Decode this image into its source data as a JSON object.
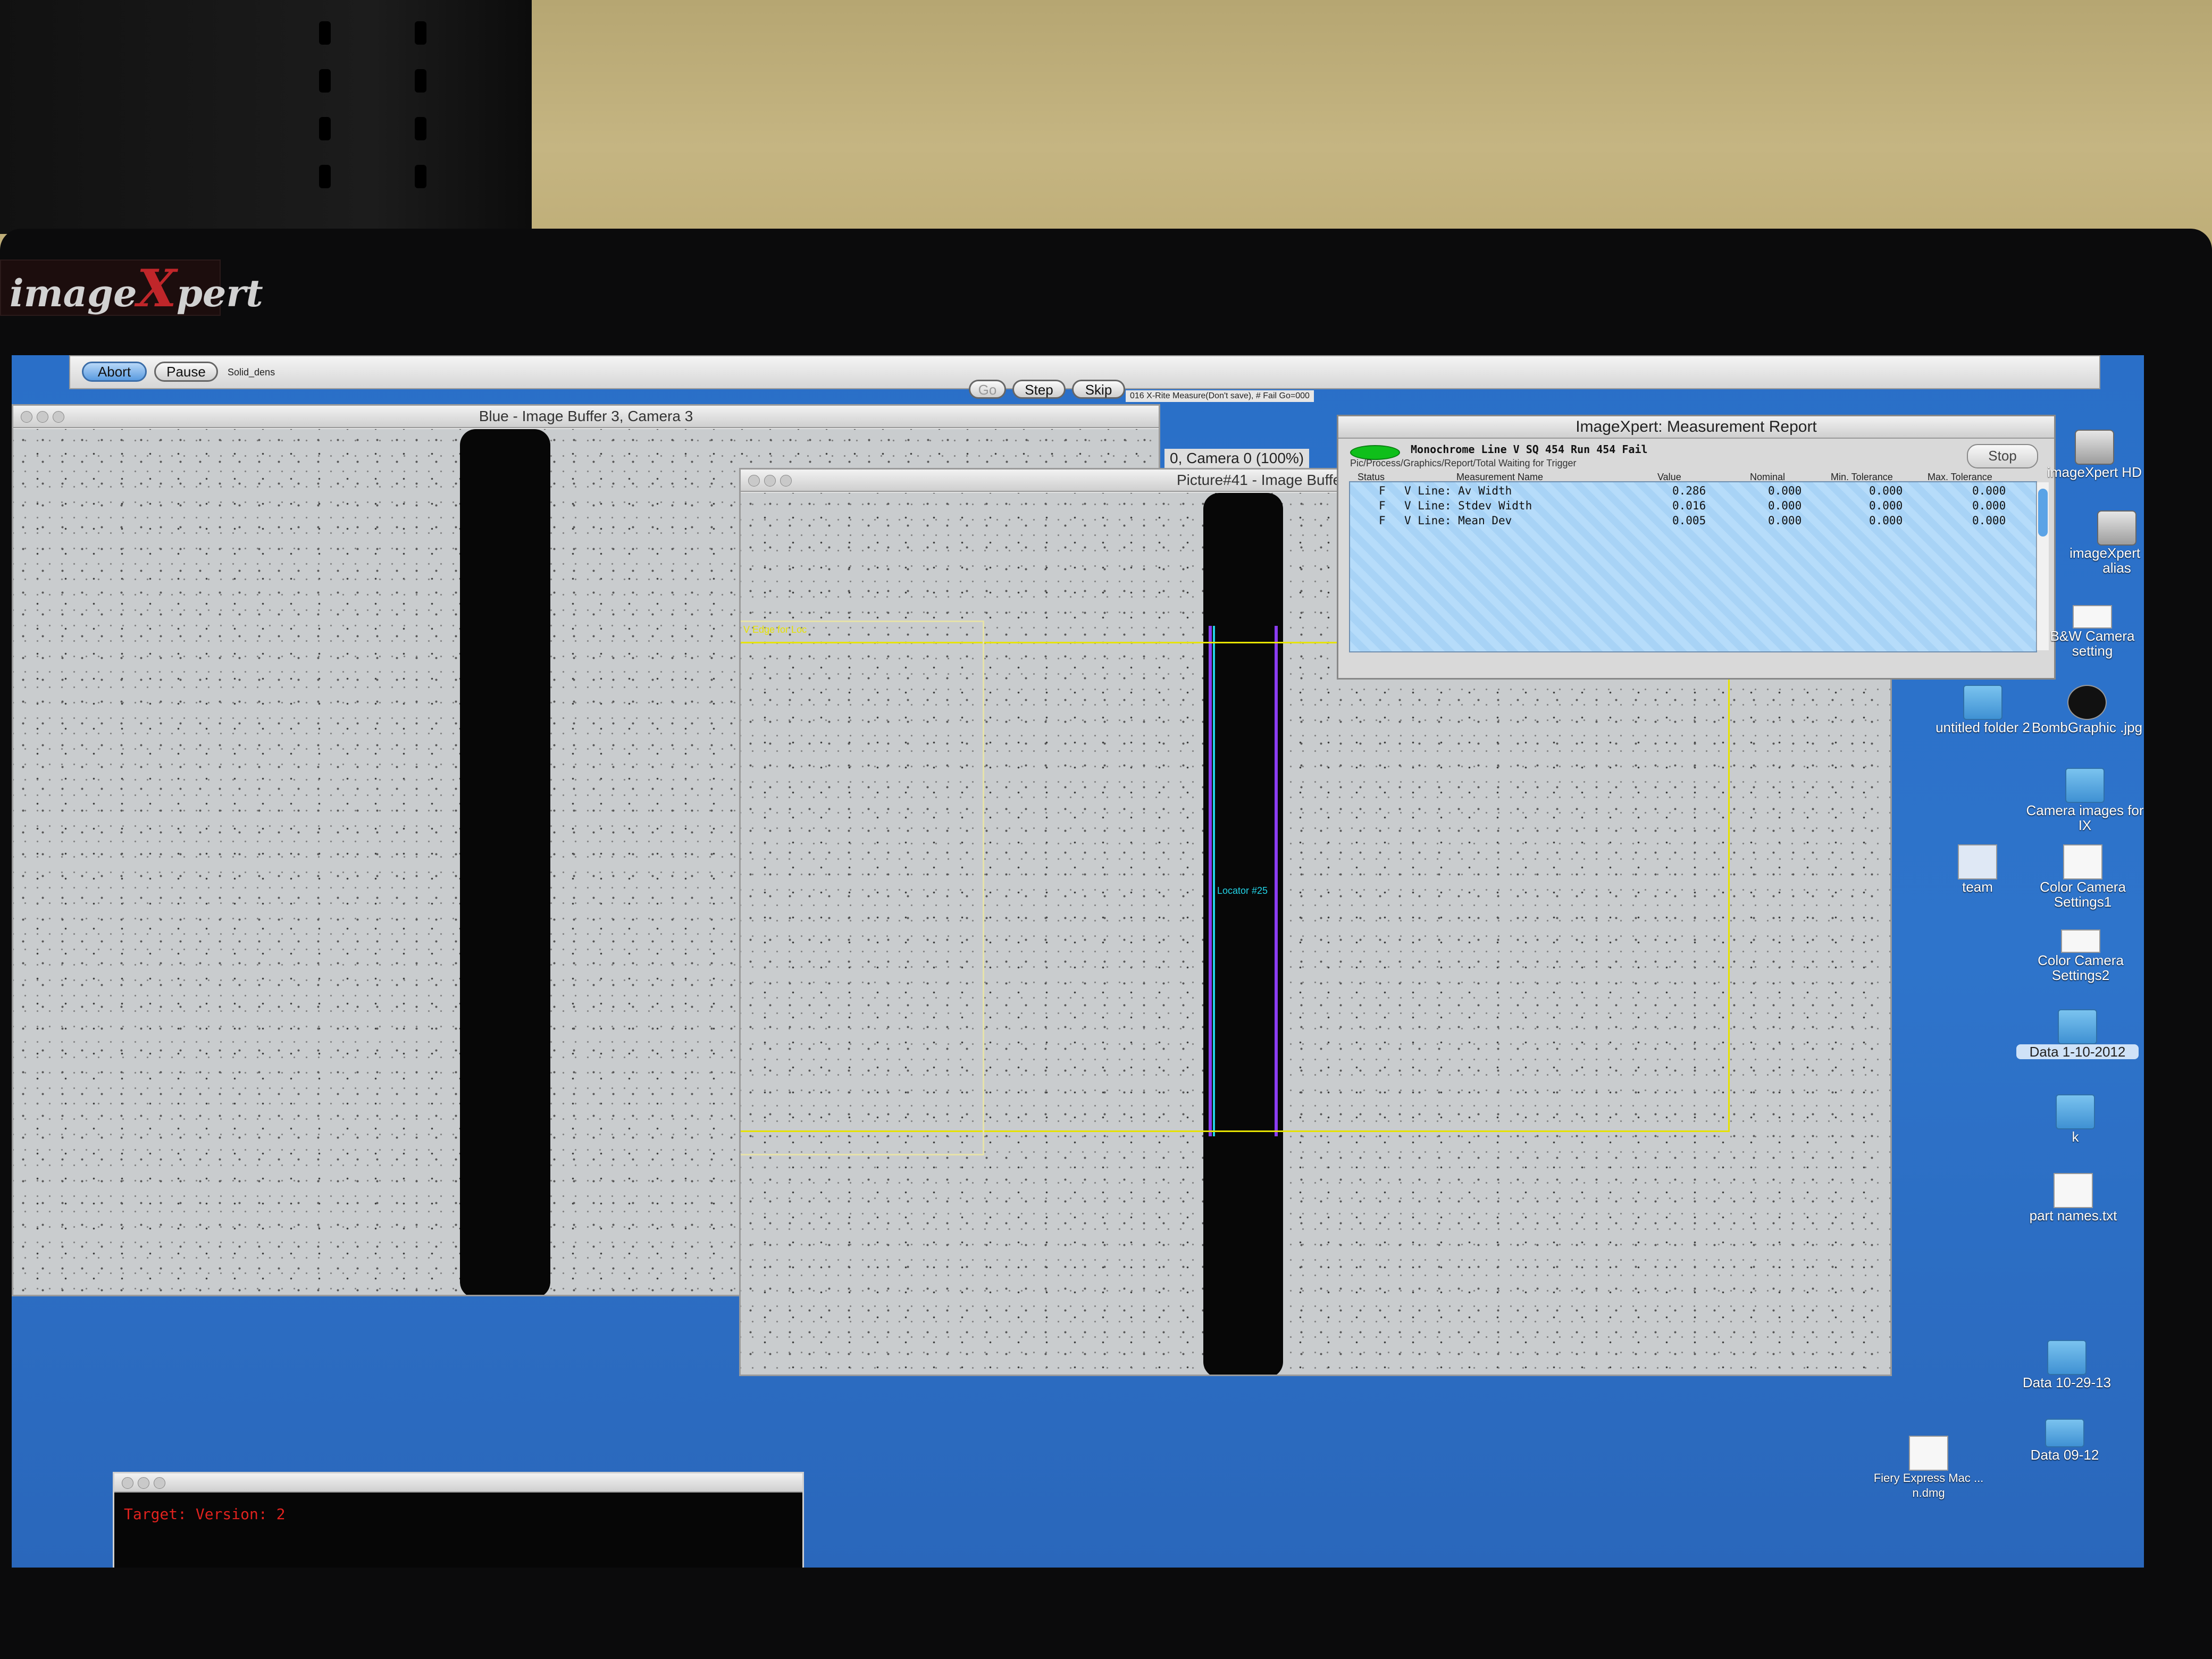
{
  "brand": {
    "logo_text": "imageXpert"
  },
  "toolbar": {
    "abort_label": "Abort",
    "pause_label": "Pause",
    "script_name": "Solid_dens",
    "go_label": "Go",
    "step_label": "Step",
    "skip_label": "Skip",
    "status_text": "016 X-Rite Measure(Don't save), # Fail Go=000"
  },
  "windows": {
    "blue_buffer_title": "Blue - Image Buffer 3, Camera 3",
    "camera_caption": "0, Camera 0  (100%)",
    "picture_title": "Picture#41 - Image Buffer",
    "roi_label": "V Edge for Loc",
    "locator_label": "Locator #25"
  },
  "report": {
    "title": "ImageXpert: Measurement Report",
    "header": "Monochrome Line V SQ  454 Run  454 Fail",
    "path": "Pic/Process/Graphics/Report/Total  Waiting for Trigger",
    "stop_label": "Stop",
    "columns": [
      "Status",
      "Measurement Name",
      "Value",
      "Nominal",
      "Min. Tolerance",
      "Max. Tolerance"
    ],
    "rows": [
      {
        "status": "F",
        "name": "V Line: Av Width",
        "value": "0.286",
        "nominal": "0.000",
        "min": "0.000",
        "max": "0.000"
      },
      {
        "status": "F",
        "name": "V Line: Stdev Width",
        "value": "0.016",
        "nominal": "0.000",
        "min": "0.000",
        "max": "0.000"
      },
      {
        "status": "F",
        "name": "V Line: Mean Dev",
        "value": "0.005",
        "nominal": "0.000",
        "min": "0.000",
        "max": "0.000"
      }
    ],
    "status_color": "#0fbf1a"
  },
  "desktop_icons": [
    {
      "label": "imageXpert HD",
      "icon": "drive-icon"
    },
    {
      "label": "imageXpert HD alias",
      "icon": "drive-icon"
    },
    {
      "label": "B&W Camera setting",
      "icon": "document-icon"
    },
    {
      "label": "untitled folder 2",
      "icon": "folder-icon"
    },
    {
      "label": "BombGraphic .jpg",
      "icon": "image-file-icon"
    },
    {
      "label": "Camera images for IX",
      "icon": "folder-icon"
    },
    {
      "label": "team",
      "icon": "group-icon"
    },
    {
      "label": "Color Camera Settings1",
      "icon": "document-icon"
    },
    {
      "label": "Color Camera Settings2",
      "icon": "document-icon"
    },
    {
      "label": "Data 1-10-2012",
      "icon": "folder-icon"
    },
    {
      "label": "k",
      "icon": "folder-icon"
    },
    {
      "label": "part names.txt",
      "icon": "text-file-icon"
    },
    {
      "label": "Data 10-29-13",
      "icon": "folder-icon"
    },
    {
      "label": "Data 09-12",
      "icon": "folder-icon"
    },
    {
      "label": "Fiery Express Mac ... n.dmg",
      "icon": "disk-image-icon"
    }
  ],
  "terminal": {
    "text": "Target: Version: 2"
  },
  "colors": {
    "desktop": "#2e74cb",
    "roi_outline": "#e6e200",
    "edge_trace": "#22d3e6",
    "edge_trace_alt": "#8a3cf0"
  }
}
